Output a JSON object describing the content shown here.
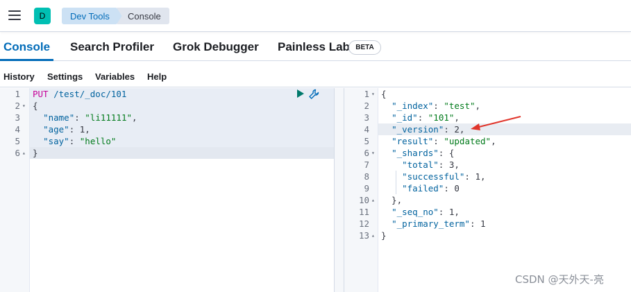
{
  "header": {
    "avatar_letter": "D",
    "breadcrumbs": [
      "Dev Tools",
      "Console"
    ]
  },
  "tabs": {
    "items": [
      "Console",
      "Search Profiler",
      "Grok Debugger",
      "Painless Lab"
    ],
    "beta_badge": "BETA",
    "active": "Console"
  },
  "menu": {
    "items": [
      "History",
      "Settings",
      "Variables",
      "Help"
    ]
  },
  "request": {
    "method": "PUT",
    "path": "/test/_doc/101",
    "line_numbers": [
      "1",
      "2",
      "3",
      "4",
      "5",
      "6"
    ],
    "lines": [
      [
        {
          "t": "PUT",
          "c": "m"
        },
        {
          "t": " /test/_doc/101",
          "c": "u"
        }
      ],
      [
        {
          "t": "{",
          "c": "p"
        }
      ],
      [
        {
          "t": "  ",
          "c": "p"
        },
        {
          "t": "\"name\"",
          "c": "k"
        },
        {
          "t": ": ",
          "c": "p"
        },
        {
          "t": "\"li11111\"",
          "c": "s"
        },
        {
          "t": ",",
          "c": "p"
        }
      ],
      [
        {
          "t": "  ",
          "c": "p"
        },
        {
          "t": "\"age\"",
          "c": "k"
        },
        {
          "t": ": 1,",
          "c": "p"
        }
      ],
      [
        {
          "t": "  ",
          "c": "p"
        },
        {
          "t": "\"say\"",
          "c": "k"
        },
        {
          "t": ": ",
          "c": "p"
        },
        {
          "t": "\"hello\"",
          "c": "s"
        }
      ],
      [
        {
          "t": "}",
          "c": "p"
        }
      ]
    ],
    "fold_markers": {
      "2": "▾",
      "6": "▴"
    }
  },
  "response": {
    "line_numbers": [
      "1",
      "2",
      "3",
      "4",
      "5",
      "6",
      "7",
      "8",
      "9",
      "10",
      "11",
      "12",
      "13"
    ],
    "lines": [
      [
        {
          "t": "{",
          "c": "p"
        }
      ],
      [
        {
          "t": "  ",
          "c": "p"
        },
        {
          "t": "\"_index\"",
          "c": "k"
        },
        {
          "t": ": ",
          "c": "p"
        },
        {
          "t": "\"test\"",
          "c": "s"
        },
        {
          "t": ",",
          "c": "p"
        }
      ],
      [
        {
          "t": "  ",
          "c": "p"
        },
        {
          "t": "\"_id\"",
          "c": "k"
        },
        {
          "t": ": ",
          "c": "p"
        },
        {
          "t": "\"101\"",
          "c": "s"
        },
        {
          "t": ",",
          "c": "p"
        }
      ],
      [
        {
          "t": "  ",
          "c": "p"
        },
        {
          "t": "\"_version\"",
          "c": "k"
        },
        {
          "t": ": 2,",
          "c": "p"
        }
      ],
      [
        {
          "t": "  ",
          "c": "p"
        },
        {
          "t": "\"result\"",
          "c": "k"
        },
        {
          "t": ": ",
          "c": "p"
        },
        {
          "t": "\"updated\"",
          "c": "s"
        },
        {
          "t": ",",
          "c": "p"
        }
      ],
      [
        {
          "t": "  ",
          "c": "p"
        },
        {
          "t": "\"_shards\"",
          "c": "k"
        },
        {
          "t": ": {",
          "c": "p"
        }
      ],
      [
        {
          "t": "    ",
          "c": "p"
        },
        {
          "t": "\"total\"",
          "c": "k"
        },
        {
          "t": ": 3,",
          "c": "p"
        }
      ],
      [
        {
          "t": "    ",
          "c": "p"
        },
        {
          "t": "\"successful\"",
          "c": "k"
        },
        {
          "t": ": 1,",
          "c": "p"
        }
      ],
      [
        {
          "t": "    ",
          "c": "p"
        },
        {
          "t": "\"failed\"",
          "c": "k"
        },
        {
          "t": ": 0",
          "c": "p"
        }
      ],
      [
        {
          "t": "  },",
          "c": "p"
        }
      ],
      [
        {
          "t": "  ",
          "c": "p"
        },
        {
          "t": "\"_seq_no\"",
          "c": "k"
        },
        {
          "t": ": 1,",
          "c": "p"
        }
      ],
      [
        {
          "t": "  ",
          "c": "p"
        },
        {
          "t": "\"_primary_term\"",
          "c": "k"
        },
        {
          "t": ": 1",
          "c": "p"
        }
      ],
      [
        {
          "t": "}",
          "c": "p"
        }
      ]
    ],
    "fold_markers": {
      "1": "▾",
      "6": "▾",
      "10": "▴",
      "13": "▴"
    }
  },
  "watermark": "CSDN @天外天-亮",
  "colors": {
    "accent": "#006bb8",
    "avatar": "#00bfb3",
    "play": "#00796b",
    "arrow": "#e0352b"
  }
}
